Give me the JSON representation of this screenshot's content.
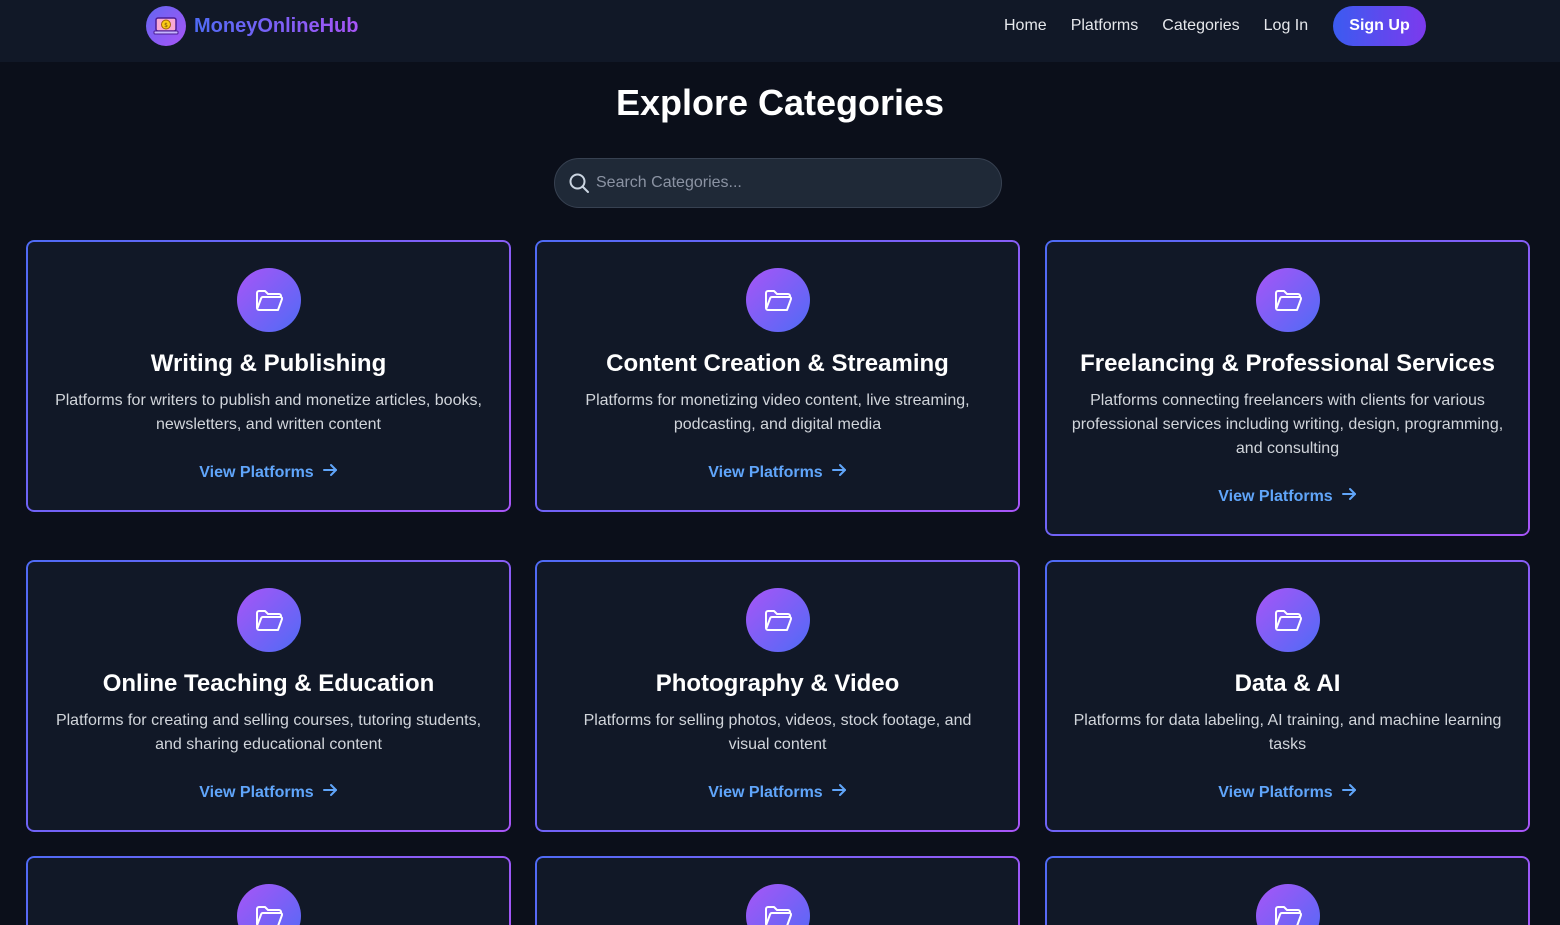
{
  "header": {
    "brand_name": "MoneyOnlineHub",
    "nav": [
      "Home",
      "Platforms",
      "Categories",
      "Log In"
    ],
    "signup_label": "Sign Up"
  },
  "main": {
    "title": "Explore Categories",
    "search_placeholder": "Search Categories...",
    "link_label": "View Platforms",
    "categories": [
      {
        "title": "Writing & Publishing",
        "description": "Platforms for writers to publish and monetize articles, books, newsletters, and written content"
      },
      {
        "title": "Content Creation & Streaming",
        "description": "Platforms for monetizing video content, live streaming, podcasting, and digital media"
      },
      {
        "title": "Freelancing & Professional Services",
        "description": "Platforms connecting freelancers with clients for various professional services including writing, design, programming, and consulting"
      },
      {
        "title": "Online Teaching & Education",
        "description": "Platforms for creating and selling courses, tutoring students, and sharing educational content"
      },
      {
        "title": "Photography & Video",
        "description": "Platforms for selling photos, videos, stock footage, and visual content"
      },
      {
        "title": "Data & AI",
        "description": "Platforms for data labeling, AI training, and machine learning tasks"
      }
    ]
  },
  "icons": {
    "brand": "money-laptop-icon",
    "category": "folder-open-icon",
    "search": "search-icon",
    "link": "arrow-right-icon"
  },
  "colors": {
    "background": "#0b0f1a",
    "navbar": "#111827",
    "card": "#111827",
    "accent_blue": "#4f6bf5",
    "accent_purple": "#a855f7",
    "link": "#60a5fa"
  }
}
